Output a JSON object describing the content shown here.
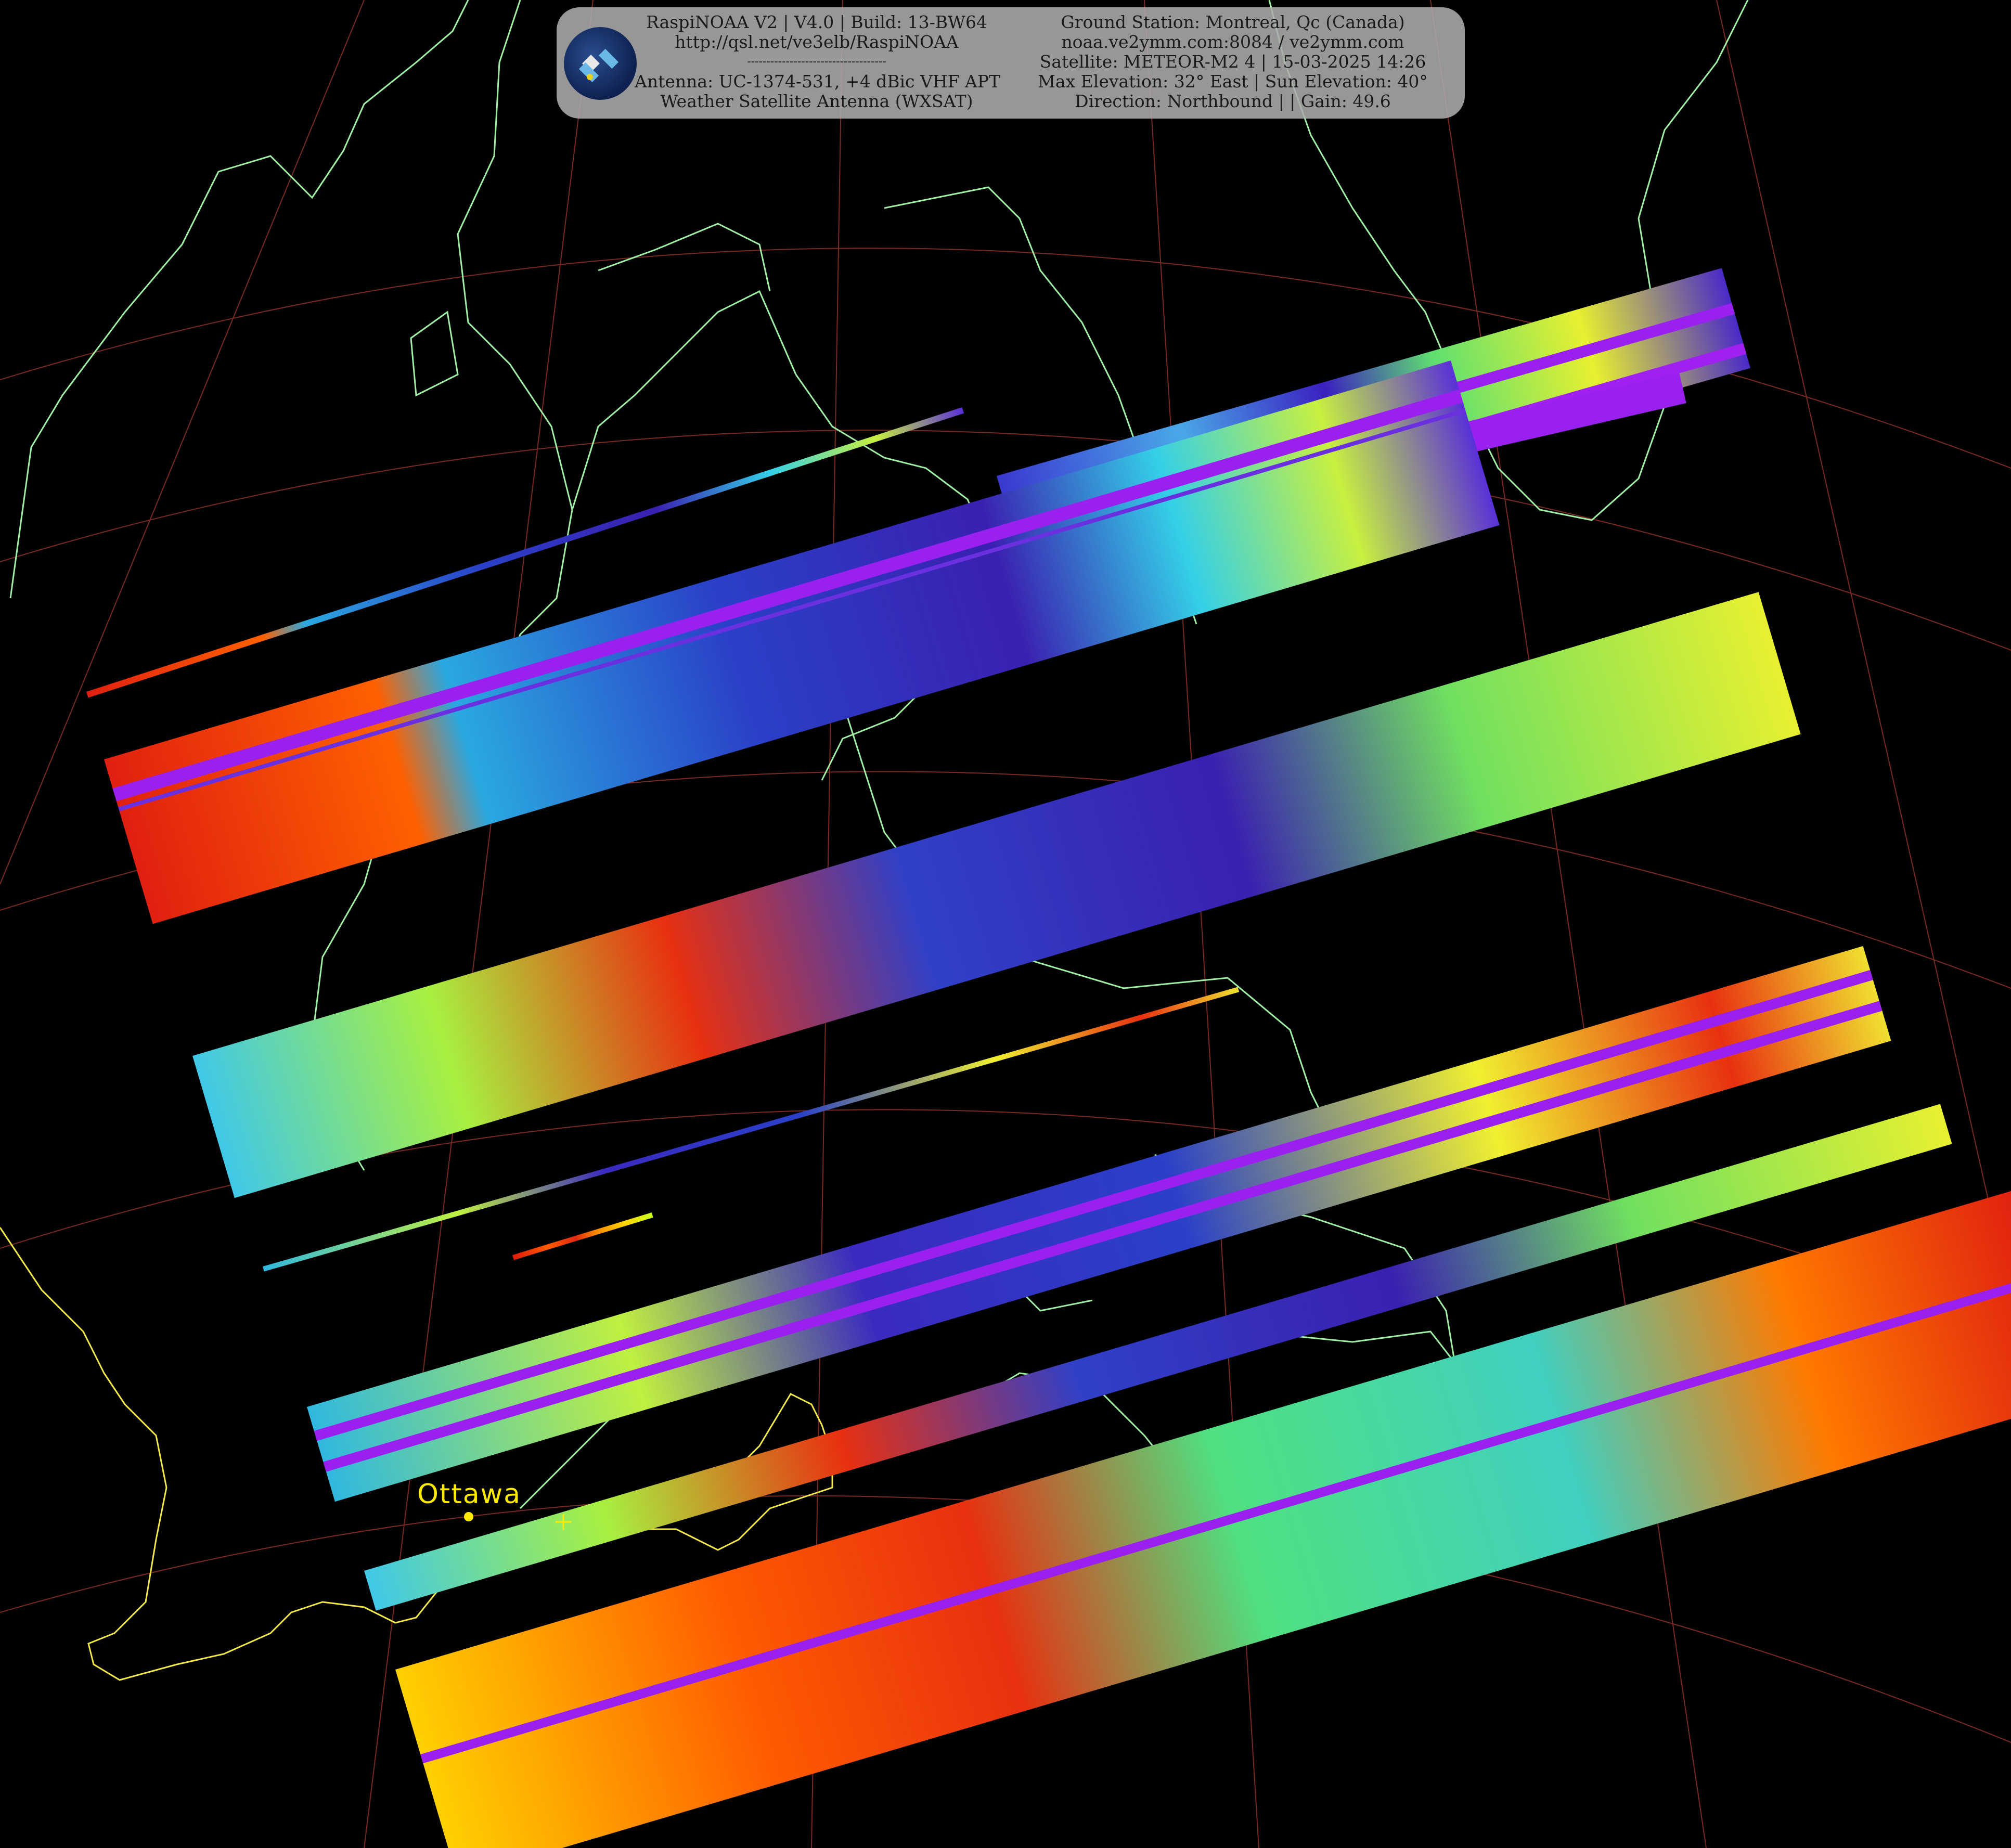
{
  "banner": {
    "line1_left": "RaspiNOAA V2 | V4.0 | Build: 13-BW64",
    "line2_left": "http://qsl.net/ve3elb/RaspiNOAA",
    "line3_left": "------------------------------------",
    "line4_left": "Antenna: UC-1374-531, +4 dBic VHF APT",
    "line5_left": "Weather Satellite Antenna (WXSAT)",
    "line1_right": "Ground Station: Montreal, Qc (Canada)",
    "line2_right": "noaa.ve2ymm.com:8084 / ve2ymm.com",
    "line3_right": "Satellite: METEOR-M2 4 | 15-03-2025 14:26",
    "line4_right": "Max Elevation: 32° East | Sun Elevation: 40°",
    "line5_right": "Direction: Northbound | | Gain: 49.6"
  },
  "map": {
    "city_label": "Ottawa",
    "coastline_color": "#9ff0a4",
    "border_color": "#f2e84a",
    "graticule_color": "#7a2a22",
    "label_color": "#ffea00"
  },
  "icons": {
    "logo": "satellite-logo-icon"
  }
}
